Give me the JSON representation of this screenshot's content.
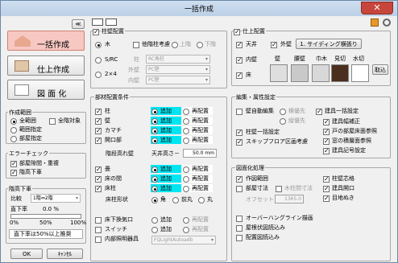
{
  "window": {
    "title": "一括作成",
    "close": "✕"
  },
  "left": {
    "collapse": "≪",
    "btn_bulk": "一括作成",
    "btn_finish": "仕上作成",
    "btn_drawing": "図 面 化",
    "range": {
      "title": "作成範囲",
      "all": "全範囲",
      "all_target": "全階対象",
      "range_spec": "範囲指定",
      "floor_spec": "部屋指定"
    },
    "error": {
      "title": "エラーチェック",
      "overlap": "部屋隙間・重複",
      "ceiling": "階高下車"
    },
    "slope": {
      "title": "階高下車",
      "ratio_label": "比較",
      "ratio_value": "1階⇔2階",
      "direct_label": "直下率",
      "direct_value": "0.0 %",
      "scale_min": "0%",
      "scale_mid": "50%",
      "scale_max": "100%",
      "note": "直下率は50%以上推奨"
    },
    "ok": "OK",
    "cancel": "ｷｬﾝｾﾙ"
  },
  "struct": {
    "title": "柱壁配置",
    "wood": "木",
    "other": "他階柱考慮",
    "upper": "上階",
    "lower": "下階",
    "src": "S/RC",
    "col_label": "柱",
    "col_value": "RC角柱",
    "two_by": "2×4",
    "wall_label": "外壁",
    "wall_value": "PC壁",
    "inner_label": "内壁",
    "inner_value": "PC壁"
  },
  "parts": {
    "title": "部材配置条件",
    "add": "追加",
    "replace": "再配置",
    "rows": [
      "柱",
      "壁",
      "カマチ",
      "開口部"
    ],
    "ceiling_label": "階段高れ壁",
    "ceiling_h": "天井高さ－",
    "ceiling_v": "50.0 mm",
    "rows2": [
      "畳",
      "床の間",
      "床柱"
    ],
    "shape_label": "床柱形状",
    "shape_square": "角",
    "shape_chamfer": "前丸",
    "shape_round": "丸",
    "rows3": [
      "床下換気口",
      "スイッチ",
      "内部照明器具"
    ],
    "light_value": "FQLightAutoadb"
  },
  "finish": {
    "title": "仕上配置",
    "ceiling": "天井",
    "outer_wall": "外壁",
    "siding": "1. サイディング横張り",
    "inner": "内壁",
    "floor": "床",
    "mat_labels": [
      "壁",
      "腰壁",
      "巾木",
      "見切",
      "水切"
    ],
    "fetch": "取込"
  },
  "edit": {
    "title": "編集・属性設定",
    "room_edit": "壁自動編集",
    "inner_pri": "横優先",
    "vert_pri": "縦優先",
    "pillar": "柱壁一括設定",
    "skip": "スキップフロア区画考慮",
    "fitting": "建具一括設定",
    "fitting_fix": "建具幅補正",
    "door_ref": "戸の部屋床面参照",
    "window_ref": "窓の積層面参照",
    "fitting_label": "建具記号設定"
  },
  "draw": {
    "title": "図面化処理",
    "range": "作図範囲",
    "room_dim": "部屋寸法",
    "wood_dim": "木柱間寸法",
    "offset_label": "オフセット",
    "offset_value": "1365.0",
    "pillar_grid": "柱壁芯格",
    "fitting_open": "建具開口",
    "grid_line": "目地ぬき",
    "hanging": "オーバーハングライン描画",
    "roof_draw": "屋根伏図読込み",
    "layout_read": "配置図読込み"
  }
}
